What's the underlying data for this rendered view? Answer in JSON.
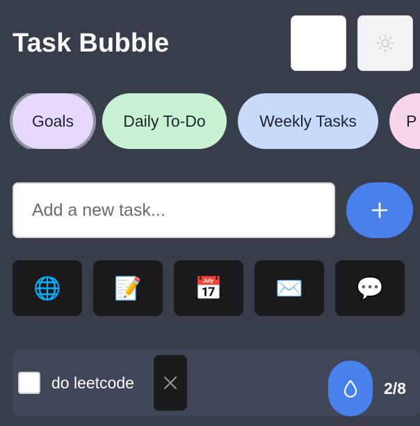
{
  "header": {
    "title": "Task Bubble",
    "theme_icon": "sun-icon"
  },
  "categories": [
    {
      "label": "Goals",
      "color": "#e6d8fb",
      "selected": true
    },
    {
      "label": "Daily To-Do",
      "color": "#c8f3d3"
    },
    {
      "label": "Weekly Tasks",
      "color": "#c6dafa"
    },
    {
      "label": "P",
      "color": "#f8d6ea"
    }
  ],
  "task_input": {
    "value": "",
    "placeholder": "Add a new task..."
  },
  "add_button": {
    "icon": "plus-icon",
    "color": "#4a80ec"
  },
  "quick_actions": [
    {
      "icon": "globe-icon",
      "glyph": "🌐"
    },
    {
      "icon": "memo-icon",
      "glyph": "📝"
    },
    {
      "icon": "calendar-icon",
      "glyph": "📅"
    },
    {
      "icon": "envelope-icon",
      "glyph": "✉️"
    },
    {
      "icon": "speech-bubble-icon",
      "glyph": "💬"
    }
  ],
  "tasks": [
    {
      "text": "do leetcode",
      "checked": false
    }
  ],
  "progress": {
    "count_text": "2/8"
  },
  "fab": {
    "icon": "droplet-icon"
  }
}
